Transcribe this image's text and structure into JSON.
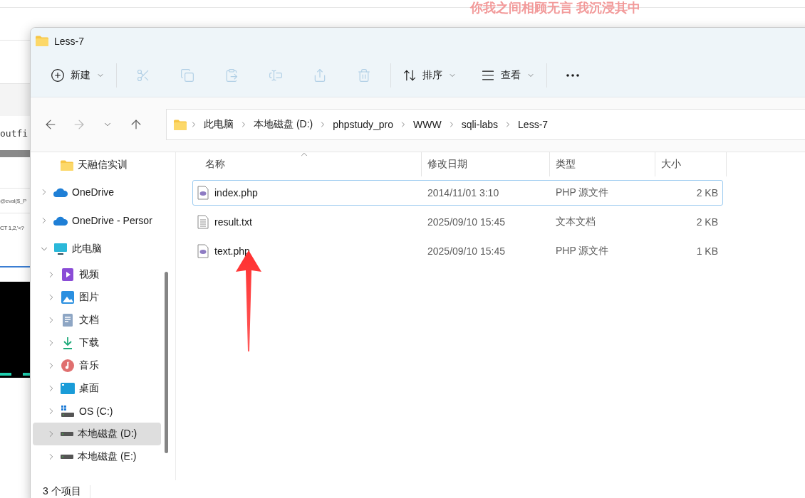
{
  "background": {
    "lyric": "你我之间相顾无言 我沉浸其中",
    "fragments": [
      "outfi",
      "@eval($_P",
      "CT 1,2,'<?"
    ]
  },
  "window": {
    "title": "Less-7"
  },
  "toolbar": {
    "items": [
      {
        "kind": "new",
        "label": "新建",
        "disabled": false
      },
      {
        "kind": "separator"
      },
      {
        "kind": "cut",
        "disabled": true
      },
      {
        "kind": "copy",
        "disabled": true
      },
      {
        "kind": "paste",
        "disabled": true
      },
      {
        "kind": "rename",
        "disabled": true
      },
      {
        "kind": "share",
        "disabled": true
      },
      {
        "kind": "delete",
        "disabled": true
      },
      {
        "kind": "separator"
      },
      {
        "kind": "sort",
        "label": "排序",
        "disabled": false
      },
      {
        "kind": "view",
        "label": "查看",
        "disabled": false
      },
      {
        "kind": "separator"
      },
      {
        "kind": "more",
        "disabled": false
      }
    ]
  },
  "history": [
    {
      "kind": "back",
      "disabled": false
    },
    {
      "kind": "forward",
      "disabled": true
    },
    {
      "kind": "recent",
      "disabled": false
    },
    {
      "kind": "up",
      "disabled": false
    }
  ],
  "address": {
    "segments": [
      "此电脑",
      "本地磁盘 (D:)",
      "phpstudy_pro",
      "WWW",
      "sqli-labs",
      "Less-7"
    ]
  },
  "navigation_pane": {
    "pinned": [
      {
        "label": "天融信实训",
        "kind": "folder",
        "selected": false
      }
    ],
    "items": [
      {
        "label": "OneDrive",
        "kind": "cloud",
        "expanded": false,
        "selected": false
      },
      {
        "label": "OneDrive - Persor",
        "kind": "cloud",
        "expanded": false,
        "selected": false
      },
      {
        "label": "此电脑",
        "kind": "computer",
        "expanded": true,
        "selected": false,
        "children": [
          {
            "label": "视频",
            "kind": "video",
            "expanded": false,
            "selected": false
          },
          {
            "label": "图片",
            "kind": "picture",
            "expanded": false,
            "selected": false
          },
          {
            "label": "文档",
            "kind": "document",
            "expanded": false,
            "selected": false
          },
          {
            "label": "下载",
            "kind": "download",
            "expanded": false,
            "selected": false
          },
          {
            "label": "音乐",
            "kind": "music",
            "expanded": false,
            "selected": false
          },
          {
            "label": "桌面",
            "kind": "desktop",
            "expanded": false,
            "selected": false
          },
          {
            "label": "OS (C:)",
            "kind": "system-drive",
            "expanded": false,
            "selected": false
          },
          {
            "label": "本地磁盘 (D:)",
            "kind": "drive",
            "expanded": false,
            "selected": true
          },
          {
            "label": "本地磁盘 (E:)",
            "kind": "drive",
            "expanded": false,
            "selected": false
          }
        ]
      }
    ]
  },
  "files": {
    "columns": [
      {
        "label": "名称",
        "sorted": true
      },
      {
        "label": "修改日期",
        "sorted": false
      },
      {
        "label": "类型",
        "sorted": false
      },
      {
        "label": "大小",
        "sorted": false
      }
    ],
    "rows": [
      {
        "name": "index.php",
        "date": "2014/11/01 3:10",
        "type": "PHP 源文件",
        "size": "2 KB",
        "kind": "php",
        "focused": true
      },
      {
        "name": "result.txt",
        "date": "2025/09/10 15:45",
        "type": "文本文档",
        "size": "2 KB",
        "kind": "text",
        "focused": false
      },
      {
        "name": "text.php",
        "date": "2025/09/10 15:45",
        "type": "PHP 源文件",
        "size": "1 KB",
        "kind": "php",
        "focused": false
      }
    ]
  },
  "status_bar": {
    "count": "3 个项目"
  }
}
